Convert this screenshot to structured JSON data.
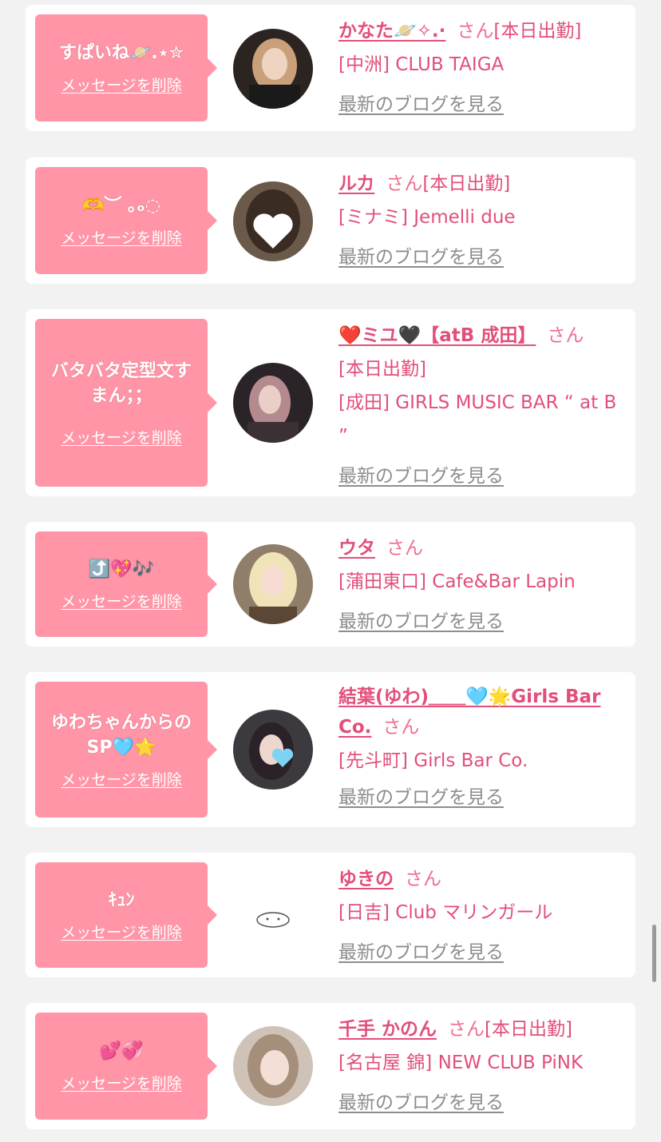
{
  "delete_label": "メッセージを削除",
  "blog_label": "最新のブログを見る",
  "san_label": "さん",
  "accent_color": "#ff95a7",
  "name_color": "#e24f79",
  "messages": [
    {
      "message": "すぱいね🪐.⋆✮",
      "name": "かなた🪐✧.·",
      "status": "[本日出勤]",
      "shop": "[中洲] CLUB TAIGA"
    },
    {
      "message": "🫶︶ ｡ₒ◌",
      "name": "ルカ",
      "status": "[本日出勤]",
      "shop": "[ミナミ] Jemelli due"
    },
    {
      "message": "バタバタ定型文すまん；；",
      "name": "❤️ミユ🖤【atB 成田】",
      "status": "[本日出勤]",
      "shop": "[成田] GIRLS MUSIC BAR “ at B ”"
    },
    {
      "message": "⤴️💖🎶",
      "name": "ウタ",
      "status": "",
      "shop": "[蒲田東口] Cafe&Bar Lapin"
    },
    {
      "message": "ゆわちゃんからのSP🩵🌟",
      "name": "結葉(ゆわ)＿＿🩵🌟Girls Bar Co.",
      "status": "",
      "shop": "[先斗町] Girls Bar Co."
    },
    {
      "message": "ｷｭﾝ",
      "name": "ゆきの",
      "status": "",
      "shop": "[日吉] Club マリンガール"
    },
    {
      "message": "💕💞",
      "name": "千手 かのん",
      "status": "[本日出勤]",
      "shop": "[名古屋 錦] NEW CLUB PiNK"
    }
  ]
}
